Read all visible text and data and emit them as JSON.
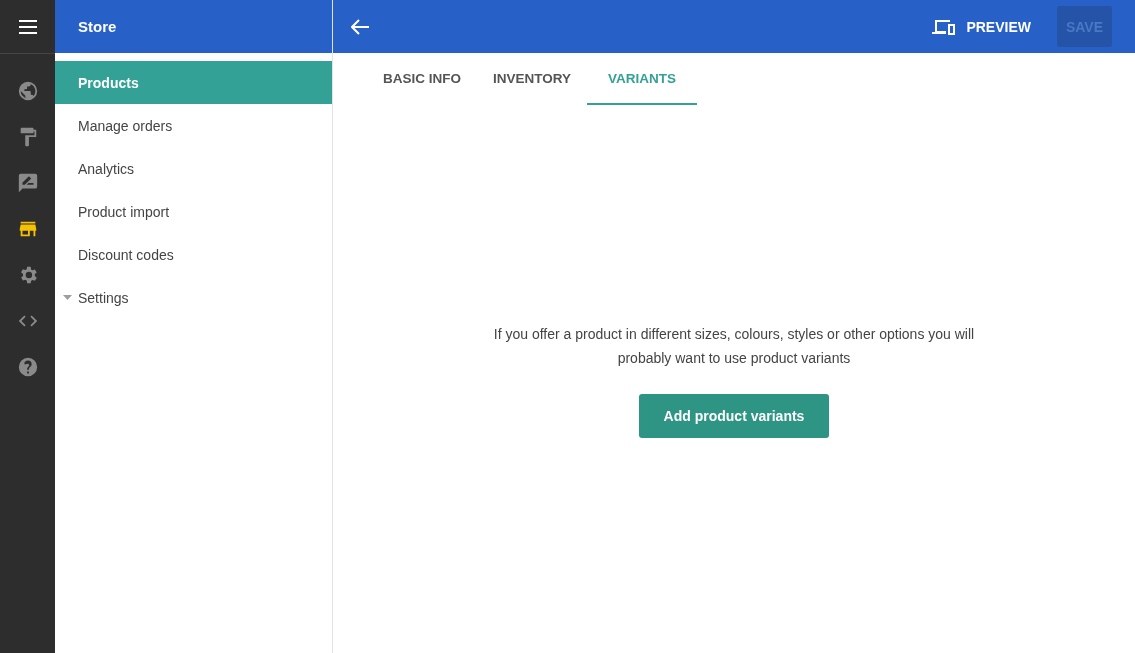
{
  "rail": {
    "items": [
      {
        "kind": "globe",
        "selected": false
      },
      {
        "kind": "roller",
        "selected": false
      },
      {
        "kind": "feedback",
        "selected": false
      },
      {
        "kind": "store",
        "selected": true
      },
      {
        "kind": "gear",
        "selected": false
      },
      {
        "kind": "code",
        "selected": false
      },
      {
        "kind": "help",
        "selected": false
      }
    ]
  },
  "sidebar": {
    "title": "Store",
    "items": [
      {
        "label": "Products",
        "kind": "link",
        "selected": true
      },
      {
        "label": "Manage orders",
        "kind": "link",
        "selected": false
      },
      {
        "label": "Analytics",
        "kind": "link",
        "selected": false
      },
      {
        "label": "Product import",
        "kind": "link",
        "selected": false
      },
      {
        "label": "Discount codes",
        "kind": "link",
        "selected": false
      },
      {
        "label": "Settings",
        "kind": "group",
        "selected": false
      }
    ]
  },
  "toolbar": {
    "preview": "PREVIEW",
    "save": {
      "label": "SAVE",
      "disabled": true
    }
  },
  "tabs": [
    {
      "label": "BASIC INFO",
      "selected": false
    },
    {
      "label": "INVENTORY",
      "selected": false
    },
    {
      "label": "VARIANTS",
      "selected": true
    }
  ],
  "empty_state": {
    "message": "If you offer a product in different sizes, colours, styles or other options you will probably want to use product variants",
    "button": "Add product variants"
  }
}
